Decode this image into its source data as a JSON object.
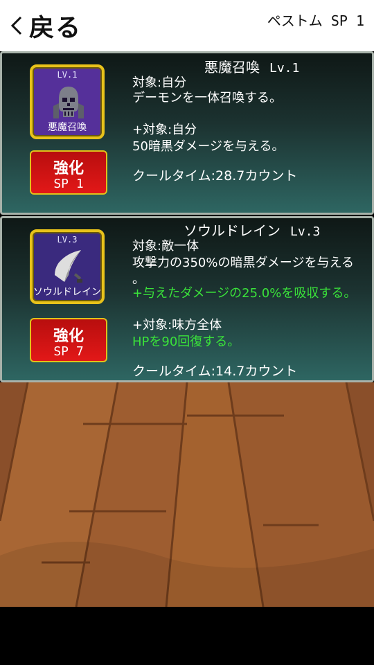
{
  "header": {
    "back_label": "戻る",
    "player_name": "ペストム",
    "sp_label": "SP 1"
  },
  "skills": [
    {
      "name": "悪魔召喚",
      "level": "Lv.1",
      "icon_level": "LV.1",
      "icon_name": "悪魔召喚",
      "icon": "skull-icon",
      "upgrade_label": "強化",
      "upgrade_cost": "SP 1",
      "lines": [
        "対象:自分",
        "デーモンを一体召喚する。",
        "+対象:自分",
        "50暗黒ダメージを与える。"
      ],
      "cooldown": "クールタイム:28.7カウント"
    },
    {
      "name": "ソウルドレイン",
      "level": "Lv.3",
      "icon_level": "LV.3",
      "icon_name": "ソウルドレイン",
      "icon": "soul-drain-icon",
      "upgrade_label": "強化",
      "upgrade_cost": "SP 7",
      "lines": [
        "対象:敵一体",
        "攻撃力の350%の暗黒ダメージを与える",
        "。",
        "+与えたダメージの25.0%を吸収する。",
        "+対象:味方全体",
        "HPを90回復する。"
      ],
      "cooldown": "クールタイム:14.7カウント"
    }
  ],
  "colors": {
    "header_bg": "#ffffff",
    "card_border": "#a8b2aa",
    "icon_border": "#e8c21a",
    "button_red": "#e21818",
    "green_text": "#3ae23a",
    "floor": "#9c5a33"
  }
}
